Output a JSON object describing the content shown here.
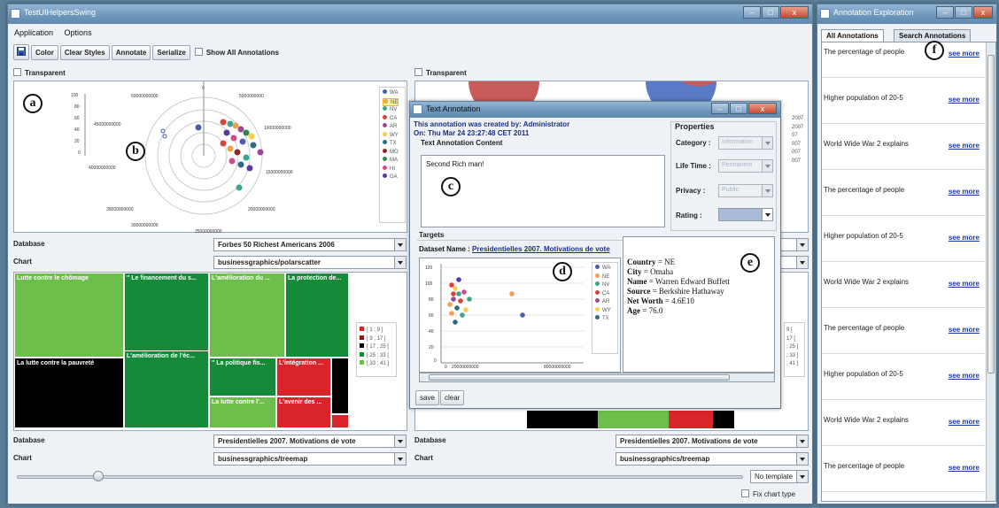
{
  "main_window": {
    "title": "TestUIHelpersSwing",
    "menu": [
      "Application",
      "Options"
    ],
    "toolbar": {
      "color": "Color",
      "clear_styles": "Clear Styles",
      "annotate": "Annotate",
      "serialize": "Serialize",
      "show_all": "Show All Annotations"
    },
    "transparent_label": "Transparent",
    "polar": {
      "r_ticks": [
        "100",
        "80",
        "60",
        "40",
        "20",
        "0"
      ],
      "angle_ticks": [
        "0",
        "5000000000",
        "10000000000",
        "15000000000",
        "20000000000",
        "25000000000",
        "30000000000",
        "35000000000",
        "40000000000",
        "45000000000",
        "50000000000"
      ],
      "legend": [
        {
          "name": "WA",
          "color": "#4a5fa8"
        },
        {
          "name": "NE",
          "color": "#f0a052"
        },
        {
          "name": "NV",
          "color": "#3aa58a"
        },
        {
          "name": "CA",
          "color": "#d9443a"
        },
        {
          "name": "AR",
          "color": "#9a4a8e"
        },
        {
          "name": "WY",
          "color": "#f6d04a"
        },
        {
          "name": "TX",
          "color": "#2c6b86"
        },
        {
          "name": "MO",
          "color": "#8a2a2a"
        },
        {
          "name": "MA",
          "color": "#2f8a4a"
        },
        {
          "name": "HI",
          "color": "#d44a8c"
        },
        {
          "name": "GA",
          "color": "#5a3aa0"
        }
      ]
    },
    "top_left": {
      "database_label": "Database",
      "database_value": "Forbes 50 Richest Americans 2006",
      "chart_label": "Chart",
      "chart_value": "businessgraphics/polarscatter"
    },
    "treemap": {
      "cells": [
        "Lutte contre le chômage",
        "\" Le financement du s...",
        "L'amélioration du ...",
        "La protection de...",
        "La lutte contre la pauvreté",
        "L'amélioration de l'éc...",
        "\" La politique fis...",
        "L'intégration ...",
        "La lutte contre l'...",
        "L'avenir des ..."
      ],
      "legend": [
        {
          "name": "[ 1 ; 9 [",
          "color": "#d9252a"
        },
        {
          "name": "[ 9 ; 17 [",
          "color": "#8a1a1a"
        },
        {
          "name": "[ 17 ; 25 [",
          "color": "#000000"
        },
        {
          "name": "[ 25 ; 33 [",
          "color": "#178a3a"
        },
        {
          "name": "[ 33 ; 41 ]",
          "color": "#6cbf4a"
        }
      ]
    },
    "bottom_left": {
      "database_label": "Database",
      "database_value": "Presidentielles 2007. Motivations de vote",
      "chart_label": "Chart",
      "chart_value": "businessgraphics/treemap"
    },
    "bottom_right": {
      "database_label": "Database",
      "database_value": "Presidentielles 2007. Motivations de vote",
      "chart_label": "Chart",
      "chart_value": "businessgraphics/treemap"
    },
    "right_partial_labels": [
      "2007",
      "2007",
      "07",
      "007",
      "007",
      "007"
    ],
    "right_partial_treemap_legend": [
      "9 [",
      "17 [",
      "; 25 [",
      "; 33 [",
      "; 41 ]"
    ],
    "template_value": "No template",
    "fix_chart_type": "Fix chart type"
  },
  "dialog": {
    "title": "Text Annotation",
    "created_by": "This annotation was created by: Administrator",
    "created_on": "On: Thu Mar 24 23:27:48 CET 2011",
    "content_label": "Text Annotation Content",
    "content_text": "Second Rich man!",
    "properties_title": "Properties",
    "category_label": "Category :",
    "category_value": "Information",
    "lifetime_label": "Life Time :",
    "lifetime_value": "Permanent",
    "privacy_label": "Privacy :",
    "privacy_value": "Public",
    "rating_label": "Rating :",
    "targets_label": "Targets",
    "dataset_prefix": "Dataset Name :",
    "dataset_name": "Presidentielles 2007. Motivations de vote",
    "scatter": {
      "y_ticks": [
        "120",
        "100",
        "80",
        "60",
        "40",
        "20",
        "0"
      ],
      "x_ticks": [
        "0",
        "20000000000",
        "80000000000"
      ],
      "legend": [
        "WA",
        "NE",
        "NV",
        "CA",
        "AR",
        "WY",
        "TX"
      ]
    },
    "details": [
      {
        "k": "Country",
        "v": "NE"
      },
      {
        "k": "City",
        "v": "Omaha"
      },
      {
        "k": "Name",
        "v": "Warren Edward Buffett"
      },
      {
        "k": "Source",
        "v": "Berkshire Hathaway"
      },
      {
        "k": "Net Worth",
        "v": "4.6E10"
      },
      {
        "k": "Age",
        "v": "76.0"
      }
    ],
    "save": "save",
    "clear": "clear"
  },
  "explorer": {
    "title": "Annotation Exploration",
    "tabs": [
      "All Annotations",
      "Search Annotations"
    ],
    "items": [
      {
        "text": "The percentage of people",
        "more": "see more"
      },
      {
        "text": "Higher population of 20-5",
        "more": "see more"
      },
      {
        "text": "World Wide War 2 explains",
        "more": "see more"
      },
      {
        "text": "The percentage of people",
        "more": "see more"
      },
      {
        "text": "Higher population of 20-5",
        "more": "see more"
      },
      {
        "text": "World Wide War 2 explains",
        "more": "see more"
      },
      {
        "text": "The percentage of people",
        "more": "see more"
      },
      {
        "text": "Higher population of 20-5",
        "more": "see more"
      },
      {
        "text": "World Wide War 2 explains",
        "more": "see more"
      },
      {
        "text": "The percentage of people",
        "more": "see more"
      }
    ]
  },
  "callouts": [
    "a",
    "b",
    "c",
    "d",
    "e",
    "f"
  ]
}
